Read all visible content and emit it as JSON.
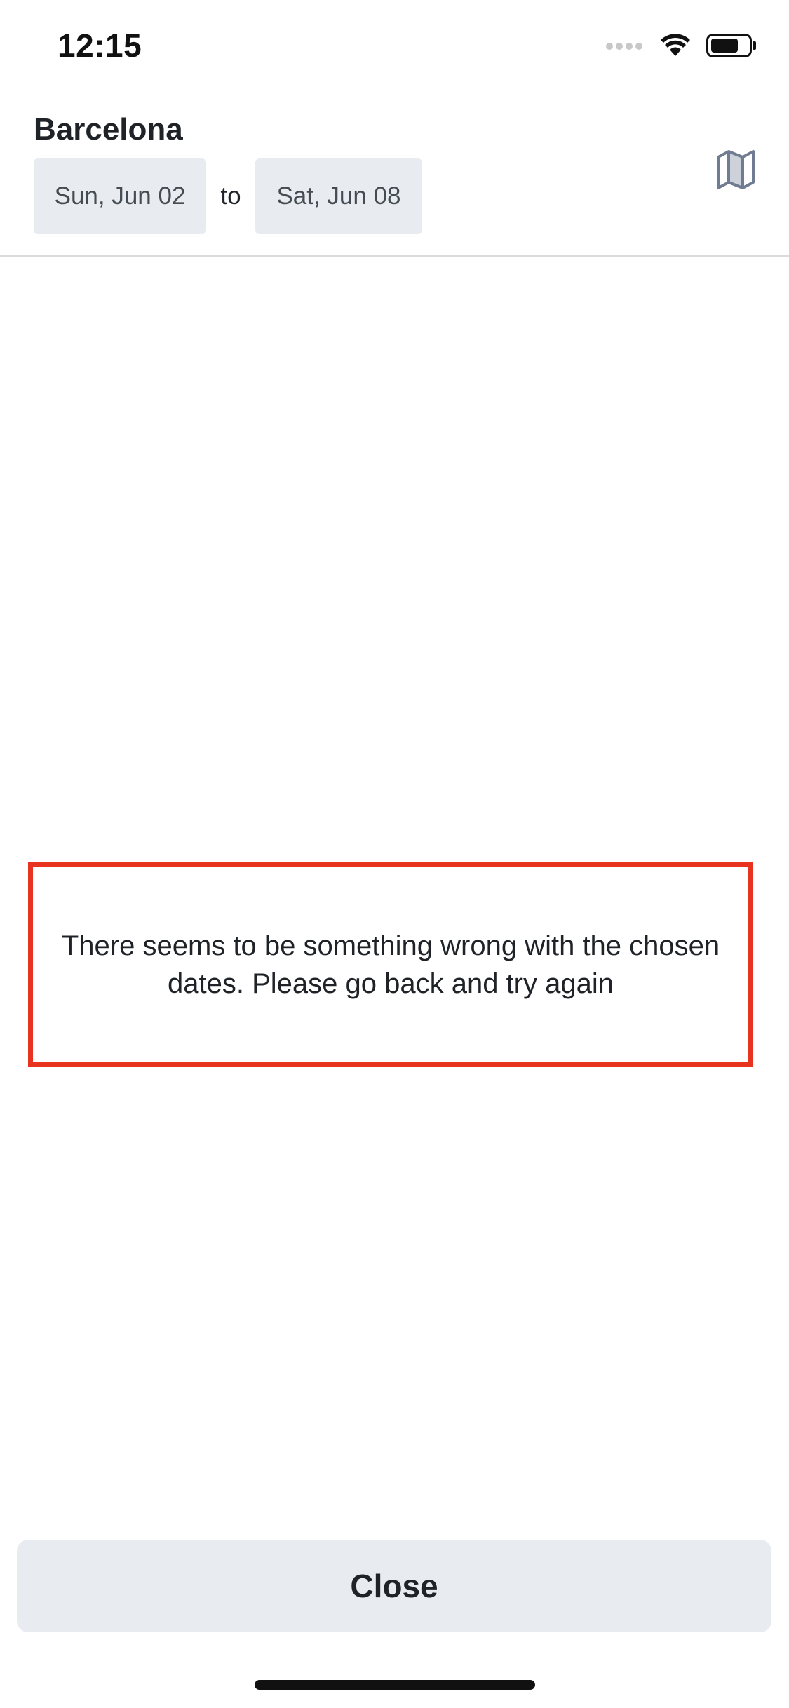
{
  "status_bar": {
    "time": "12:15",
    "icons": [
      "signal-dots-icon",
      "wifi-icon",
      "battery-icon"
    ]
  },
  "header": {
    "city": "Barcelona",
    "start_date": "Sun, Jun 02",
    "separator": "to",
    "end_date": "Sat, Jun 08",
    "map_icon": "map-icon"
  },
  "error": {
    "message": "There seems to be something wrong with the chosen dates. Please go back and try again",
    "border_color": "#e8341f"
  },
  "footer": {
    "close_label": "Close"
  },
  "colors": {
    "chip_background": "#e8ecf0",
    "icon_gray": "#6f7c91",
    "divider": "#d9dcdf"
  }
}
